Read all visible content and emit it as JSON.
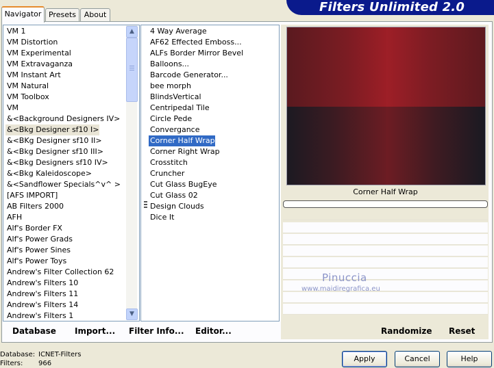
{
  "app": {
    "title": "Filters Unlimited 2.0",
    "accent": "#0a1a8c"
  },
  "tabs": [
    {
      "label": "Navigator",
      "active": true
    },
    {
      "label": "Presets",
      "active": false
    },
    {
      "label": "About",
      "active": false
    }
  ],
  "categories": [
    "VM 1",
    "VM Distortion",
    "VM Experimental",
    "VM Extravaganza",
    "VM Instant Art",
    "VM Natural",
    "VM Toolbox",
    "VM",
    "&<Background Designers IV>",
    "&<Bkg Designer sf10 I>",
    "&<BKg Designer sf10 II>",
    "&<Bkg Designer sf10 III>",
    "&<Bkg Designers sf10 IV>",
    "&<Bkg Kaleidoscope>",
    "&<Sandflower Specials^v^ >",
    "[AFS IMPORT]",
    "AB Filters 2000",
    "AFH",
    "Alf's Border FX",
    "Alf's Power Grads",
    "Alf's Power Sines",
    "Alf's Power Toys",
    "Andrew's Filter Collection 62",
    "Andrew's Filters 10",
    "Andrew's Filters 11",
    "Andrew's Filters 14",
    "Andrew's Filters 1"
  ],
  "selected_category": "&<Bkg Designer sf10 I>",
  "filters": [
    "4 Way Average",
    "AF62 Effected Emboss...",
    "ALFs Border Mirror Bevel",
    "Balloons...",
    "Barcode Generator...",
    "bee morph",
    "BlindsVertical",
    "Centripedal Tile",
    "Circle Pede",
    "Convergance",
    "Corner Half Wrap",
    "Corner Right Wrap",
    "Crosstitch",
    "Cruncher",
    "Cut Glass  BugEye",
    "Cut Glass 02",
    "Design Clouds",
    "Dice It"
  ],
  "selected_filter": "Corner Half Wrap",
  "preview": {
    "label": "Corner Half Wrap"
  },
  "watermark": {
    "main": "Pinuccia",
    "sub": "www.maidiregrafica.eu"
  },
  "bottom_bar": {
    "database": "Database",
    "import": "Import...",
    "filter_info": "Filter Info...",
    "editor": "Editor...",
    "randomize": "Randomize",
    "reset": "Reset"
  },
  "status": {
    "database_label": "Database:",
    "database_value": "ICNET-Filters",
    "filters_label": "Filters:",
    "filters_value": "966"
  },
  "buttons": {
    "apply": "Apply",
    "cancel": "Cancel",
    "help": "Help"
  }
}
